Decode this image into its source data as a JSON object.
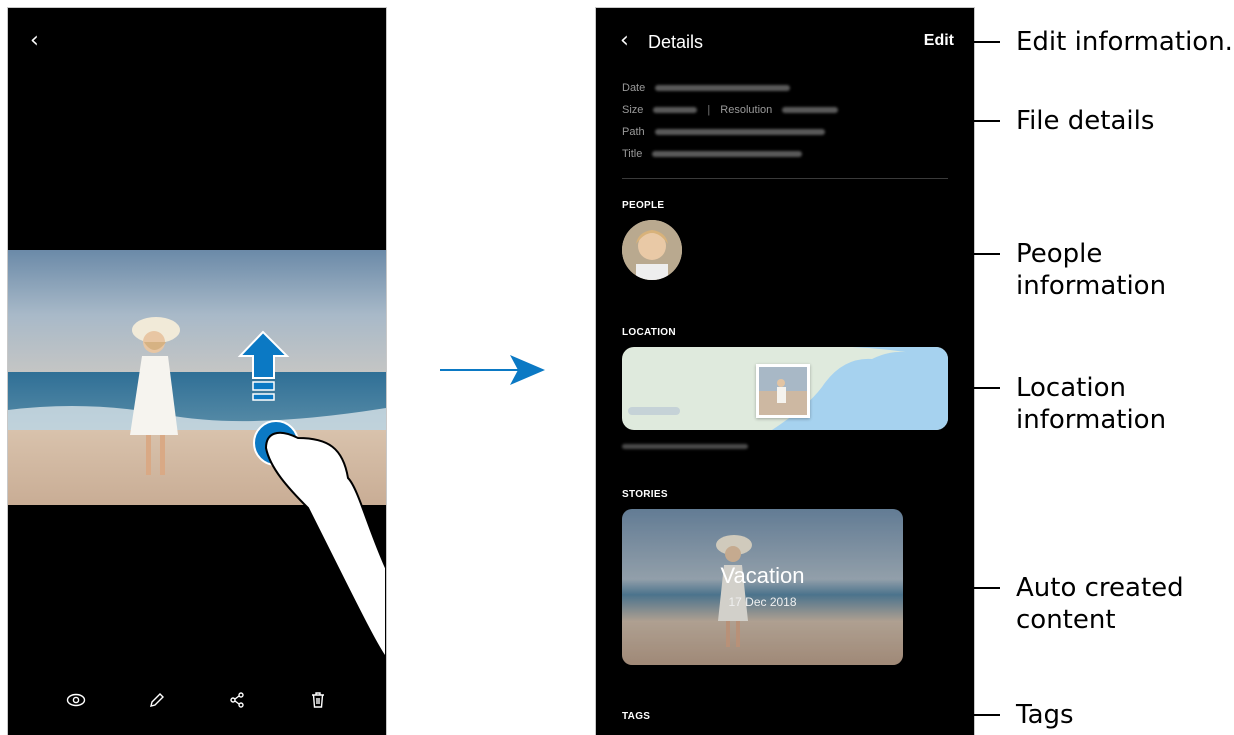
{
  "left_screen": {
    "bottom_bar_icons": [
      "eye-icon",
      "pencil-icon",
      "share-icon",
      "trash-icon"
    ]
  },
  "details_screen": {
    "header": {
      "title": "Details",
      "edit_label": "Edit"
    },
    "info_labels": {
      "date": "Date",
      "size": "Size",
      "resolution": "Resolution",
      "path": "Path",
      "title": "Title"
    },
    "sections": {
      "people": "PEOPLE",
      "location": "LOCATION",
      "stories": "STORIES",
      "tags": "TAGS"
    },
    "story": {
      "title": "Vacation",
      "date": "17 Dec 2018"
    }
  },
  "callouts": {
    "edit": "Edit information.",
    "file_details": "File details",
    "people_line1": "People",
    "people_line2": "information",
    "location_line1": "Location",
    "location_line2": "information",
    "auto_line1": "Auto created",
    "auto_line2": "content",
    "tags": "Tags"
  },
  "colors": {
    "accent": "#0b79c4",
    "phone_bg": "#000000",
    "map_water": "#a6d2ef",
    "map_land": "#dfeadd"
  }
}
